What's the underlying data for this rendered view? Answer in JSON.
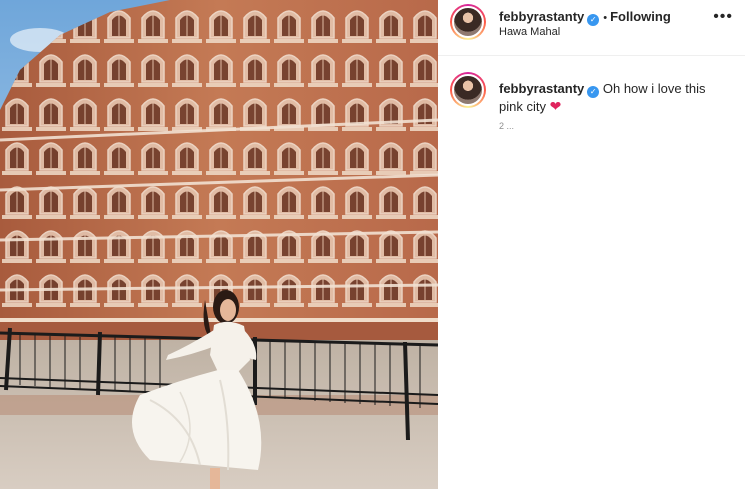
{
  "post": {
    "username": "febbyrastanty",
    "verified_icon": "✓",
    "separator": "•",
    "follow_status": "Following",
    "location": "Hawa Mahal",
    "more_icon": "•••",
    "caption_username": "febbyrastanty",
    "caption_text": "Oh how i love this pink city",
    "caption_emoji": "❤",
    "caption_meta": "2 ..."
  },
  "colors": {
    "verified": "#3897f0",
    "heart": "#e0245e",
    "facade": "#b46a48",
    "sky": "#7fb2e0"
  }
}
